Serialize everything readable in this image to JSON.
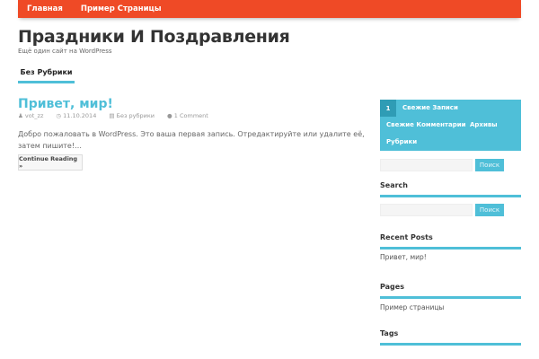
{
  "nav": [
    "Главная",
    "Пример Страницы"
  ],
  "site": {
    "title": "Праздники И Поздравления",
    "tagline": "Ещё один сайт на WordPress"
  },
  "category_tab": "Без Рубрики",
  "post": {
    "title": "Привет, мир!",
    "author": "vot_zz",
    "date": "11.10.2014",
    "category": "Без рубрики",
    "comments": "1 Comment",
    "excerpt": "Добро пожаловать в WordPress. Это ваша первая запись. Отредактируйте или удалите её, затем пишите!…",
    "more": "Continue Reading »"
  },
  "sidebar": {
    "tabs": {
      "num": "1",
      "items": [
        "Свежие Записи",
        "Свежие Комментарии",
        "Архивы",
        "Рубрики"
      ]
    },
    "search_button": "Поиск",
    "search_title": "Search",
    "recent_title": "Recent Posts",
    "recent_items": [
      "Привет, мир!"
    ],
    "pages_title": "Pages",
    "pages_items": [
      "Пример страницы"
    ],
    "tags_title": "Tags"
  },
  "colors": {
    "nav": "#ef4a26",
    "accent": "#4fbfd8"
  }
}
